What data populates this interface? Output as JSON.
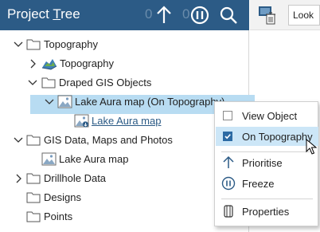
{
  "header": {
    "title_prefix": "Project ",
    "title_underlined": "T",
    "title_suffix": "ree",
    "count_left": "0",
    "count_right": "0"
  },
  "tree": {
    "items": [
      {
        "label": "Topography"
      },
      {
        "label": "Topography"
      },
      {
        "label": "Draped GIS Objects"
      },
      {
        "label": "Lake Aura map (On Topography)"
      },
      {
        "label": "Lake Aura map"
      },
      {
        "label": "GIS Data, Maps and Photos"
      },
      {
        "label": "Lake Aura map"
      },
      {
        "label": "Drillhole Data"
      },
      {
        "label": "Designs"
      },
      {
        "label": "Points"
      }
    ]
  },
  "toolbar": {
    "look_label": "Look"
  },
  "context_menu": {
    "items": [
      {
        "label": "View Object",
        "checked": false
      },
      {
        "label": "On Topography",
        "checked": true
      },
      {
        "label": "Prioritise"
      },
      {
        "label": "Freeze"
      },
      {
        "label": "Properties"
      }
    ]
  },
  "colors": {
    "header_bg": "#2c5b86",
    "selection": "#b8dcf2",
    "menu_highlight": "#cce6f7",
    "accent": "#2c6aa3"
  }
}
